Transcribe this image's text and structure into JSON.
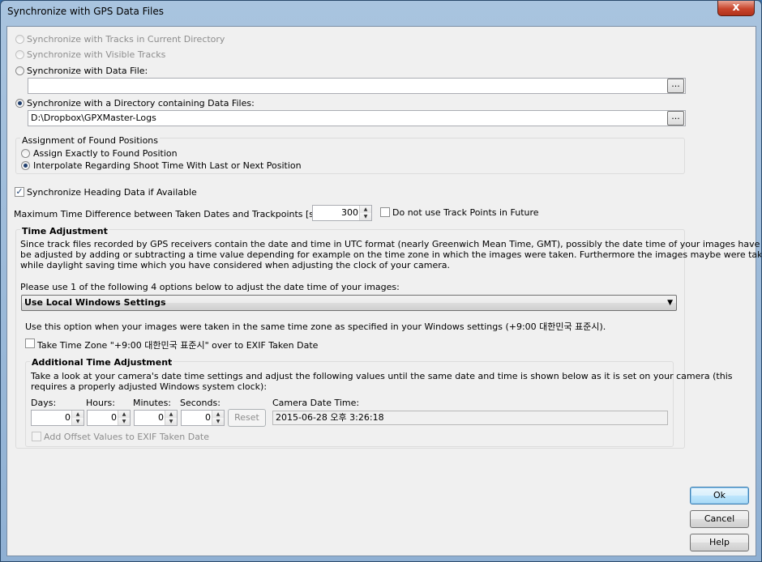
{
  "window": {
    "title": "Synchronize with GPS Data Files",
    "close_glyph": "x"
  },
  "sync": {
    "tracks_current_dir": "Synchronize with Tracks in Current Directory",
    "visible_tracks": "Synchronize with Visible Tracks",
    "data_file": "Synchronize with Data File:",
    "data_file_value": "",
    "directory": "Synchronize with a Directory containing Data Files:",
    "directory_value": "D:\\Dropbox\\GPXMaster-Logs",
    "browse": "..."
  },
  "assignment": {
    "title": "Assignment of Found Positions",
    "exact": "Assign Exactly to Found Position",
    "interpolate": "Interpolate Regarding Shoot Time With Last or Next Position"
  },
  "heading": {
    "label": "Synchronize Heading Data if Available",
    "checked": "✓"
  },
  "max_diff": {
    "label": "Maximum Time Difference between Taken Dates and Trackpoints [seconds]:",
    "value": "300",
    "future_label": "Do not use Track Points in Future"
  },
  "time_adjustment": {
    "title": "Time Adjustment",
    "description_1": "Since track files recorded by GPS receivers contain the date and time in UTC format (nearly Greenwich Mean Time, GMT), possibly the date time of your images have to",
    "description_2": "be adjusted by adding or subtracting a time value depending for example on the time zone in which the images were taken. Furthermore the images maybe were taken",
    "description_3": "while daylight saving time which you have considered when adjusting the clock of your camera.",
    "options_prompt": "Please use 1 of the following 4 options below to adjust the date time of your images:",
    "selected_option": "Use Local Windows Settings",
    "option_info": "Use this option when your images were taken in the same time zone as specified in your Windows settings (+9:00 대한민국 표준시).",
    "take_tz_label": "Take Time Zone \"+9:00 대한민국 표준시\" over to EXIF Taken Date"
  },
  "additional": {
    "title": "Additional Time Adjustment",
    "description_1": "Take a look at your camera's date time settings and adjust the following values until the same date and time is shown below as it is  set on your camera (this",
    "description_2": "requires a properly adjusted Windows system clock):",
    "days_label": "Days:",
    "hours_label": "Hours:",
    "minutes_label": "Minutes:",
    "seconds_label": "Seconds:",
    "days": "0",
    "hours": "0",
    "minutes": "0",
    "seconds": "0",
    "reset": "Reset",
    "camera_dt_label": "Camera Date Time:",
    "camera_dt_value": "2015-06-28 오후 3:26:18",
    "add_offset_label": "Add Offset Values to EXIF Taken Date"
  },
  "buttons": {
    "ok": "Ok",
    "cancel": "Cancel",
    "help": "Help"
  }
}
